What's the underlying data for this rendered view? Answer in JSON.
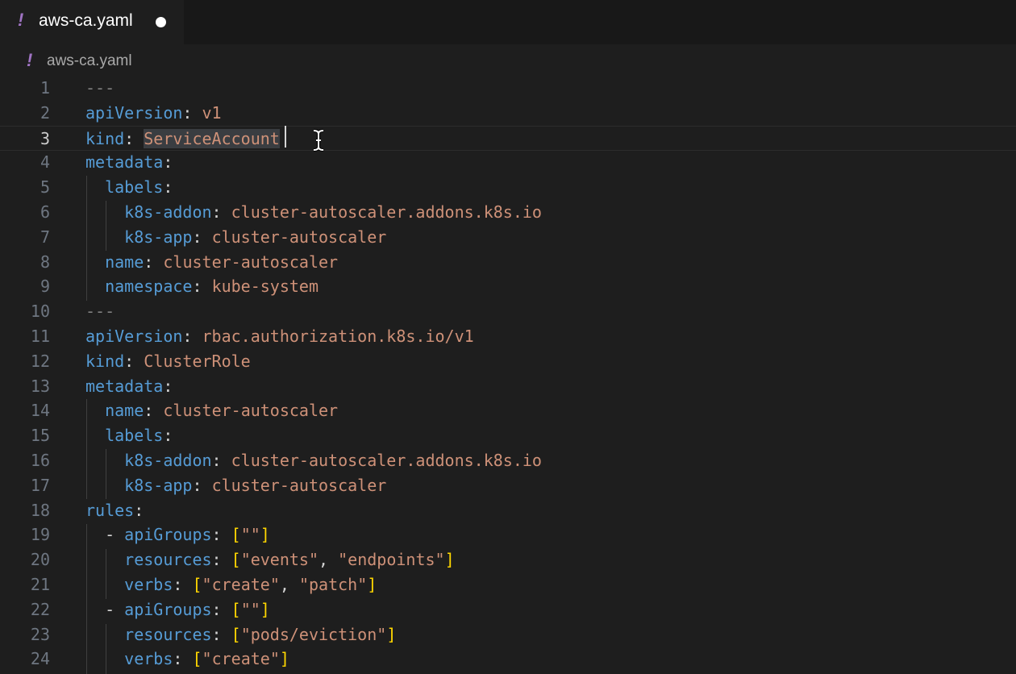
{
  "tab": {
    "icon": "!",
    "label": "aws-ca.yaml",
    "dirty_indicator": "dot-icon"
  },
  "breadcrumb": {
    "icon": "!",
    "label": "aws-ca.yaml"
  },
  "editor": {
    "current_line": 3,
    "selection": "ServiceAccount",
    "lines": [
      {
        "n": "1",
        "segments": [
          {
            "t": "---",
            "c": "sep"
          }
        ]
      },
      {
        "n": "2",
        "segments": [
          {
            "t": "apiVersion",
            "c": "k"
          },
          {
            "t": ": ",
            "c": "p"
          },
          {
            "t": "v1",
            "c": "s"
          }
        ]
      },
      {
        "n": "3",
        "segments": [
          {
            "t": "kind",
            "c": "k"
          },
          {
            "t": ": ",
            "c": "p"
          },
          {
            "t": "ServiceAccount",
            "c": "sel"
          }
        ]
      },
      {
        "n": "4",
        "segments": [
          {
            "t": "metadata",
            "c": "k"
          },
          {
            "t": ":",
            "c": "p"
          }
        ]
      },
      {
        "n": "5",
        "segments": [
          {
            "t": "  ",
            "c": "p"
          },
          {
            "t": "labels",
            "c": "k"
          },
          {
            "t": ":",
            "c": "p"
          }
        ]
      },
      {
        "n": "6",
        "segments": [
          {
            "t": "    ",
            "c": "p"
          },
          {
            "t": "k8s-addon",
            "c": "k"
          },
          {
            "t": ": ",
            "c": "p"
          },
          {
            "t": "cluster-autoscaler.addons.k8s.io",
            "c": "s"
          }
        ]
      },
      {
        "n": "7",
        "segments": [
          {
            "t": "    ",
            "c": "p"
          },
          {
            "t": "k8s-app",
            "c": "k"
          },
          {
            "t": ": ",
            "c": "p"
          },
          {
            "t": "cluster-autoscaler",
            "c": "s"
          }
        ]
      },
      {
        "n": "8",
        "segments": [
          {
            "t": "  ",
            "c": "p"
          },
          {
            "t": "name",
            "c": "k"
          },
          {
            "t": ": ",
            "c": "p"
          },
          {
            "t": "cluster-autoscaler",
            "c": "s"
          }
        ]
      },
      {
        "n": "9",
        "segments": [
          {
            "t": "  ",
            "c": "p"
          },
          {
            "t": "namespace",
            "c": "k"
          },
          {
            "t": ": ",
            "c": "p"
          },
          {
            "t": "kube-system",
            "c": "s"
          }
        ]
      },
      {
        "n": "10",
        "segments": [
          {
            "t": "---",
            "c": "sep"
          }
        ]
      },
      {
        "n": "11",
        "segments": [
          {
            "t": "apiVersion",
            "c": "k"
          },
          {
            "t": ": ",
            "c": "p"
          },
          {
            "t": "rbac.authorization.k8s.io/v1",
            "c": "s"
          }
        ]
      },
      {
        "n": "12",
        "segments": [
          {
            "t": "kind",
            "c": "k"
          },
          {
            "t": ": ",
            "c": "p"
          },
          {
            "t": "ClusterRole",
            "c": "s"
          }
        ]
      },
      {
        "n": "13",
        "segments": [
          {
            "t": "metadata",
            "c": "k"
          },
          {
            "t": ":",
            "c": "p"
          }
        ]
      },
      {
        "n": "14",
        "segments": [
          {
            "t": "  ",
            "c": "p"
          },
          {
            "t": "name",
            "c": "k"
          },
          {
            "t": ": ",
            "c": "p"
          },
          {
            "t": "cluster-autoscaler",
            "c": "s"
          }
        ]
      },
      {
        "n": "15",
        "segments": [
          {
            "t": "  ",
            "c": "p"
          },
          {
            "t": "labels",
            "c": "k"
          },
          {
            "t": ":",
            "c": "p"
          }
        ]
      },
      {
        "n": "16",
        "segments": [
          {
            "t": "    ",
            "c": "p"
          },
          {
            "t": "k8s-addon",
            "c": "k"
          },
          {
            "t": ": ",
            "c": "p"
          },
          {
            "t": "cluster-autoscaler.addons.k8s.io",
            "c": "s"
          }
        ]
      },
      {
        "n": "17",
        "segments": [
          {
            "t": "    ",
            "c": "p"
          },
          {
            "t": "k8s-app",
            "c": "k"
          },
          {
            "t": ": ",
            "c": "p"
          },
          {
            "t": "cluster-autoscaler",
            "c": "s"
          }
        ]
      },
      {
        "n": "18",
        "segments": [
          {
            "t": "rules",
            "c": "k"
          },
          {
            "t": ":",
            "c": "p"
          }
        ]
      },
      {
        "n": "19",
        "segments": [
          {
            "t": "  - ",
            "c": "p"
          },
          {
            "t": "apiGroups",
            "c": "k"
          },
          {
            "t": ": ",
            "c": "p"
          },
          {
            "t": "[",
            "c": "b"
          },
          {
            "t": "\"\"",
            "c": "s"
          },
          {
            "t": "]",
            "c": "b"
          }
        ]
      },
      {
        "n": "20",
        "segments": [
          {
            "t": "    ",
            "c": "p"
          },
          {
            "t": "resources",
            "c": "k"
          },
          {
            "t": ": ",
            "c": "p"
          },
          {
            "t": "[",
            "c": "b"
          },
          {
            "t": "\"events\"",
            "c": "s"
          },
          {
            "t": ", ",
            "c": "p"
          },
          {
            "t": "\"endpoints\"",
            "c": "s"
          },
          {
            "t": "]",
            "c": "b"
          }
        ]
      },
      {
        "n": "21",
        "segments": [
          {
            "t": "    ",
            "c": "p"
          },
          {
            "t": "verbs",
            "c": "k"
          },
          {
            "t": ": ",
            "c": "p"
          },
          {
            "t": "[",
            "c": "b"
          },
          {
            "t": "\"create\"",
            "c": "s"
          },
          {
            "t": ", ",
            "c": "p"
          },
          {
            "t": "\"patch\"",
            "c": "s"
          },
          {
            "t": "]",
            "c": "b"
          }
        ]
      },
      {
        "n": "22",
        "segments": [
          {
            "t": "  - ",
            "c": "p"
          },
          {
            "t": "apiGroups",
            "c": "k"
          },
          {
            "t": ": ",
            "c": "p"
          },
          {
            "t": "[",
            "c": "b"
          },
          {
            "t": "\"\"",
            "c": "s"
          },
          {
            "t": "]",
            "c": "b"
          }
        ]
      },
      {
        "n": "23",
        "segments": [
          {
            "t": "    ",
            "c": "p"
          },
          {
            "t": "resources",
            "c": "k"
          },
          {
            "t": ": ",
            "c": "p"
          },
          {
            "t": "[",
            "c": "b"
          },
          {
            "t": "\"pods/eviction\"",
            "c": "s"
          },
          {
            "t": "]",
            "c": "b"
          }
        ]
      },
      {
        "n": "24",
        "segments": [
          {
            "t": "    ",
            "c": "p"
          },
          {
            "t": "verbs",
            "c": "k"
          },
          {
            "t": ": ",
            "c": "p"
          },
          {
            "t": "[",
            "c": "b"
          },
          {
            "t": "\"create\"",
            "c": "s"
          },
          {
            "t": "]",
            "c": "b"
          }
        ]
      }
    ]
  },
  "colors": {
    "key": "#569cd6",
    "string": "#ce9178",
    "bracket": "#ffd700",
    "background": "#1e1e1e",
    "yaml_icon": "#a074c4"
  }
}
